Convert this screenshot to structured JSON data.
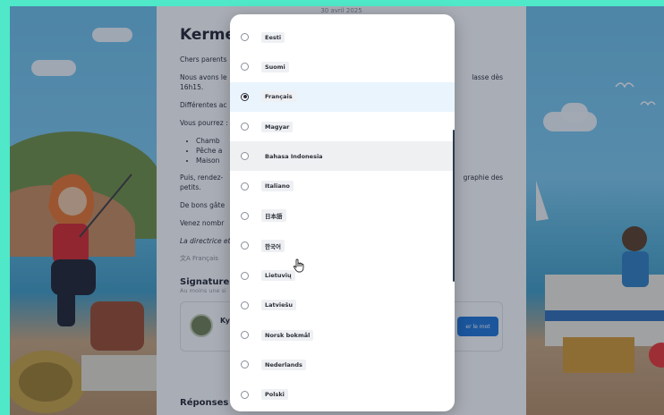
{
  "page": {
    "date": "30 avril 2025",
    "title": "Kermes",
    "paragraphs": [
      "Chers parents",
      "Nous avons le",
      "16h15.",
      "Différentes ac",
      "Vous pourrez :"
    ],
    "bullets": [
      "Chamb",
      "Pêche a",
      "Maison"
    ],
    "right_fragments": [
      "lasse dès",
      "graphie des"
    ],
    "p_after": [
      "Puis, rendez-",
      "petits.",
      "De bons gâte",
      "Venez nombr",
      "La directrice et"
    ],
    "lang_tag": "Français",
    "signature_title": "Signature",
    "signature_sub": "Au moins une si",
    "signer_initials": "Ky",
    "sign_button": "er le mot",
    "replies_title": "Réponses p"
  },
  "language_options": [
    {
      "label": "Eesti",
      "selected": false
    },
    {
      "label": "Suomi",
      "selected": false
    },
    {
      "label": "Français",
      "selected": true
    },
    {
      "label": "Magyar",
      "selected": false
    },
    {
      "label": "Bahasa Indonesia",
      "selected": false
    },
    {
      "label": "Italiano",
      "selected": false
    },
    {
      "label": "日本語",
      "selected": false
    },
    {
      "label": "한국어",
      "selected": false
    },
    {
      "label": "Lietuvių",
      "selected": false
    },
    {
      "label": "Latviešu",
      "selected": false
    },
    {
      "label": "Norsk bokmål",
      "selected": false
    },
    {
      "label": "Nederlands",
      "selected": false
    },
    {
      "label": "Polski",
      "selected": false
    }
  ],
  "colors": {
    "frame": "#4fe8c8",
    "accent": "#1a73d9",
    "selected_row": "#eaf4fd"
  }
}
